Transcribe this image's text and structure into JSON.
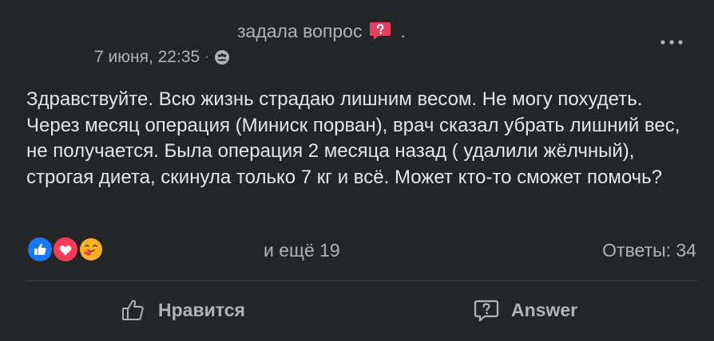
{
  "header": {
    "action_text": "задала вопрос",
    "trailing_dot": ".",
    "timestamp": "7 июня, 22:35",
    "separator": "·",
    "question_badge_icon": "question-bubble-icon",
    "privacy_icon": "group-privacy-icon",
    "more_icon": "more-horizontal-icon"
  },
  "post": {
    "text": "Здравствуйте. Всю жизнь страдаю лишним весом. Не могу похудеть. Через месяц операция (Миниск порван), врач сказал убрать лишний вес, не получается. Была операция 2 месяца назад ( удалили жёлчный), строгая диета, скинула только 7 кг и всё. Может кто-то сможет помочь?"
  },
  "reactions": {
    "icons": [
      "like-reaction-icon",
      "love-reaction-icon",
      "care-reaction-icon"
    ],
    "more_text": "и ещё 19",
    "answers_text": "Ответы: 34"
  },
  "actions": {
    "like_label": "Нравится",
    "answer_label": "Answer"
  },
  "colors": {
    "background": "#242526",
    "text_primary": "#e4e6eb",
    "text_secondary": "#b0b3b8",
    "like_blue": "#1877f2",
    "love_red": "#f33e58",
    "badge_red": "#e4405f"
  }
}
